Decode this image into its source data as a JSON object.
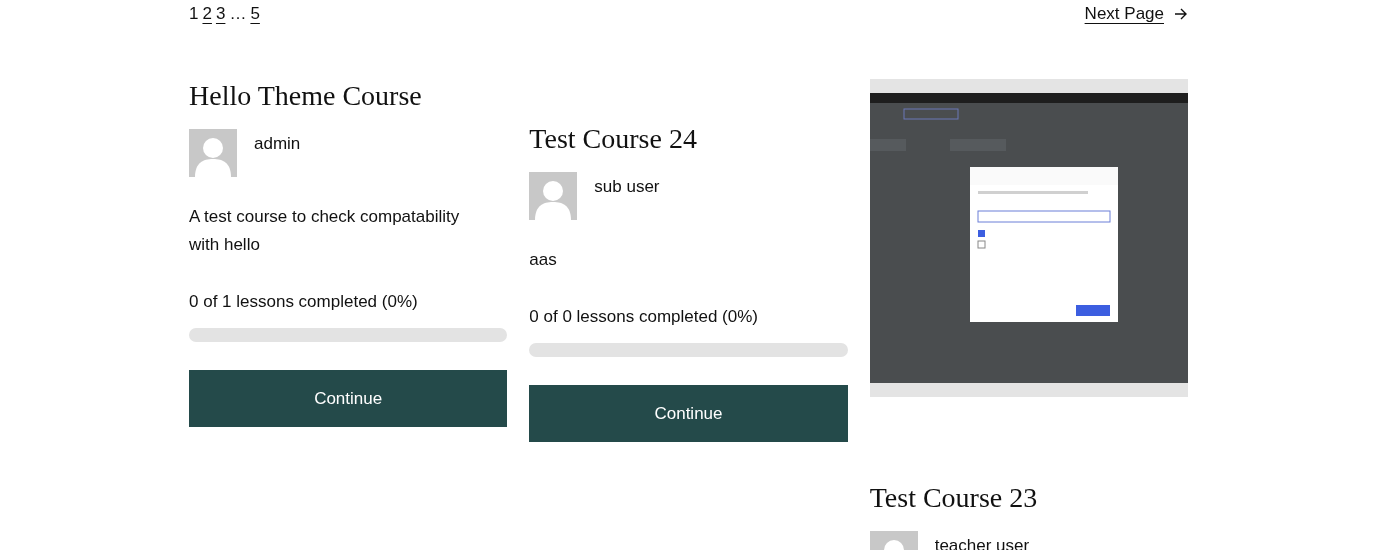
{
  "pagination": {
    "pages": [
      {
        "label": "1",
        "selected": true
      },
      {
        "label": "2",
        "selected": false
      },
      {
        "label": "3",
        "selected": false
      },
      {
        "label": "…",
        "kind": "ellipsis"
      },
      {
        "label": "5",
        "selected": false
      }
    ],
    "next": "Next Page"
  },
  "columns": [
    [
      {
        "kind": "course",
        "title": "Hello Theme Course",
        "author": "admin",
        "description": "A test course to check compatability with hello",
        "progress": "0 of 1 lessons completed (0%)",
        "level": 0,
        "button": "Continue"
      }
    ],
    [
      {
        "kind": "course",
        "title": "Test Course 24",
        "author": "sub user",
        "description": "aas",
        "progress": "0 of 0 lessons completed (0%)",
        "level": 0,
        "button": "Continue"
      }
    ],
    [
      {
        "kind": "picture"
      },
      {
        "kind": "course",
        "title": "Test Course 23",
        "author": "teacher user"
      }
    ]
  ]
}
